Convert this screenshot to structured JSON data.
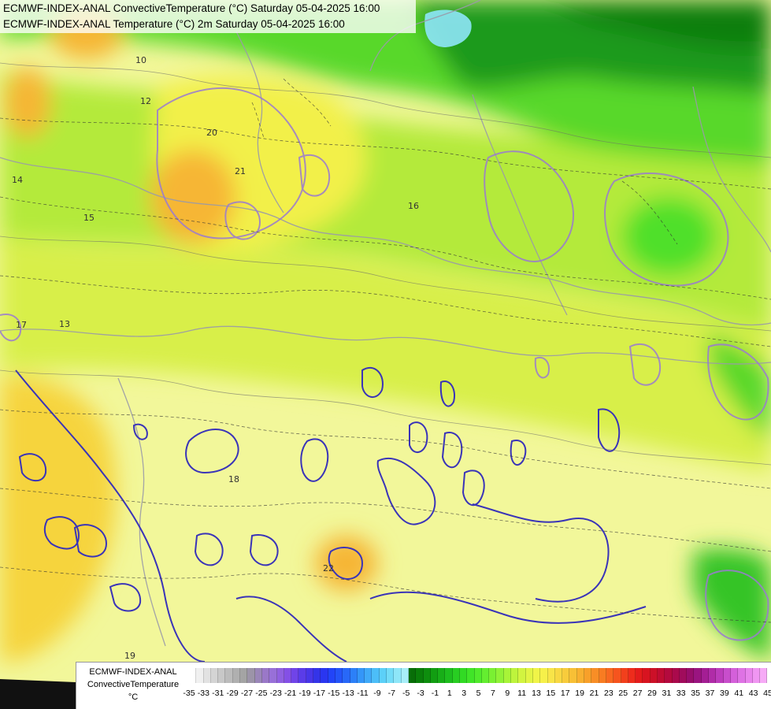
{
  "titles": {
    "line1": "ECMWF-INDEX-ANAL ConvectiveTemperature (°C) Saturday 05-04-2025 16:00",
    "line2": "ECMWF-INDEX-ANAL Temperature (°C) 2m Saturday 05-04-2025 16:00"
  },
  "legend": {
    "model": "ECMWF-INDEX-ANAL",
    "variable": "ConvectiveTemperature",
    "unit": "°C",
    "ticks": [
      "-35",
      "-33",
      "-31",
      "-29",
      "-27",
      "-25",
      "-23",
      "-21",
      "-19",
      "-17",
      "-15",
      "-13",
      "-11",
      "-9",
      "-7",
      "-5",
      "-3",
      "-1",
      "1",
      "3",
      "5",
      "7",
      "9",
      "11",
      "13",
      "15",
      "17",
      "19",
      "21",
      "23",
      "25",
      "27",
      "29",
      "31",
      "33",
      "35",
      "37",
      "39",
      "41",
      "43",
      "45"
    ],
    "colors": [
      "#ffffff",
      "#f0f0f0",
      "#e2e2e2",
      "#d4d4d4",
      "#c8c8c8",
      "#bcbcbc",
      "#b0b0b0",
      "#a4a4a4",
      "#9c94a8",
      "#9a86b8",
      "#9a78c8",
      "#9870d8",
      "#9060e0",
      "#8450e6",
      "#7044e8",
      "#5a3ce8",
      "#4836e8",
      "#3434e8",
      "#2a36f0",
      "#2244f8",
      "#2454f8",
      "#2868f8",
      "#2c80f8",
      "#3496f8",
      "#40aaf8",
      "#4cbef8",
      "#5cd0f8",
      "#72dcf8",
      "#8ee6f8",
      "#a8eef8",
      "#086e08",
      "#0a7e0a",
      "#0e8e0e",
      "#129e12",
      "#18ae18",
      "#1ebe1e",
      "#28ce22",
      "#32da24",
      "#40e428",
      "#50ea2c",
      "#64ee30",
      "#7af032",
      "#90f236",
      "#a8f438",
      "#bef43c",
      "#d2f440",
      "#e2f444",
      "#f0f448",
      "#f6f04a",
      "#f8e448",
      "#f8d842",
      "#f8cc3c",
      "#f8c036",
      "#f8b030",
      "#f8a02a",
      "#f88e26",
      "#f87c22",
      "#f86820",
      "#f6541e",
      "#f2401c",
      "#ee2c1c",
      "#e41c1c",
      "#d81420",
      "#cc1028",
      "#c00c32",
      "#b40a3e",
      "#aa0a4c",
      "#a00c5c",
      "#980e6c",
      "#9a1480",
      "#a41e94",
      "#b02ca8",
      "#bc3cbc",
      "#c84ecc",
      "#d460da",
      "#de72e4",
      "#e884ec",
      "#f096f2",
      "#f6aaf6"
    ],
    "palette_note": ""
  },
  "map": {
    "contour_labels": [
      {
        "text": "10"
      },
      {
        "text": "12"
      },
      {
        "text": "13"
      },
      {
        "text": "14"
      },
      {
        "text": "15"
      },
      {
        "text": "16"
      },
      {
        "text": "17"
      },
      {
        "text": "18"
      },
      {
        "text": "19"
      },
      {
        "text": "20"
      },
      {
        "text": "21"
      },
      {
        "text": "22"
      }
    ]
  }
}
